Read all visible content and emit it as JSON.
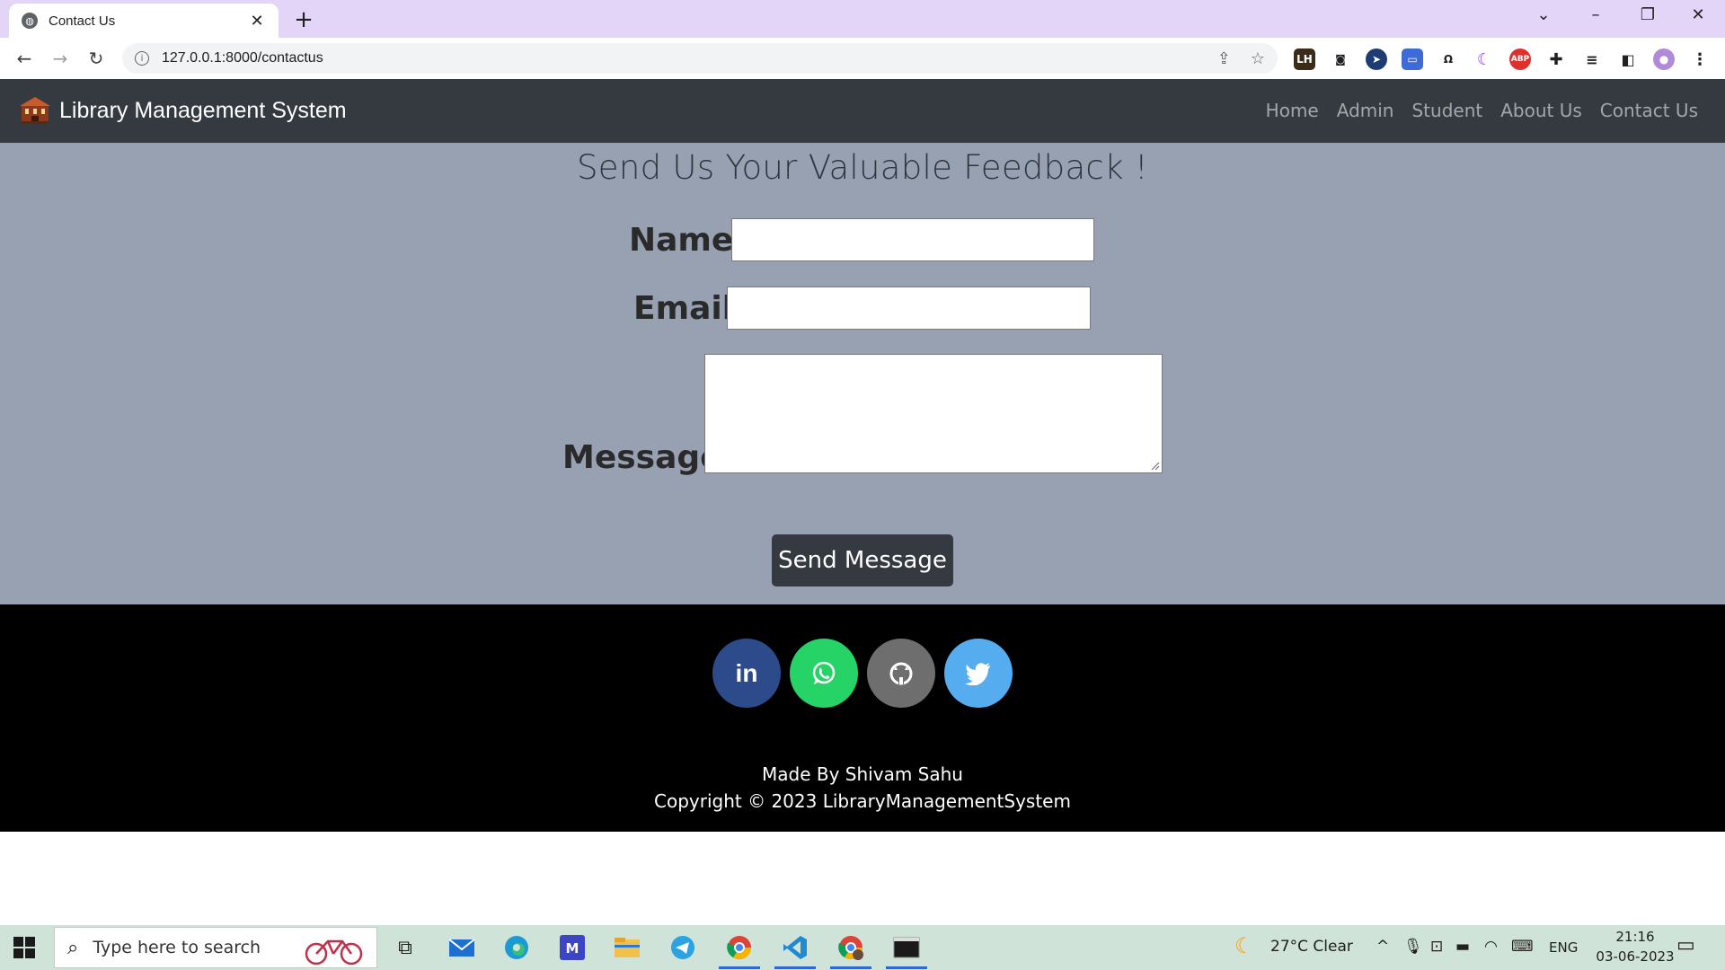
{
  "browser": {
    "tab_title": "Contact Us",
    "url": "127.0.0.1:8000/contactus"
  },
  "site": {
    "brand": "Library Management System",
    "nav": [
      "Home",
      "Admin",
      "Student",
      "About Us",
      "Contact Us"
    ]
  },
  "form": {
    "heading": "Send Us Your Valuable Feedback !",
    "name_label": "Name:",
    "email_label": "Email:",
    "message_label": "Message:",
    "name_value": "",
    "email_value": "",
    "message_value": "",
    "submit_label": "Send Message"
  },
  "footer": {
    "social": [
      "linkedin",
      "whatsapp",
      "github",
      "twitter"
    ],
    "made_by": "Made By Shivam Sahu",
    "copyright": "Copyright © 2023 LibraryManagementSystem"
  },
  "colors": {
    "navbar": "#343a40",
    "main_bg": "#97a1b2",
    "linkedin": "#2d4b8b",
    "whatsapp": "#25d366",
    "github": "#6e6e6e",
    "twitter": "#55acee"
  },
  "taskbar": {
    "search_placeholder": "Type here to search",
    "weather": "27°C  Clear",
    "language": "ENG",
    "time": "21:16",
    "date": "03-06-2023"
  }
}
